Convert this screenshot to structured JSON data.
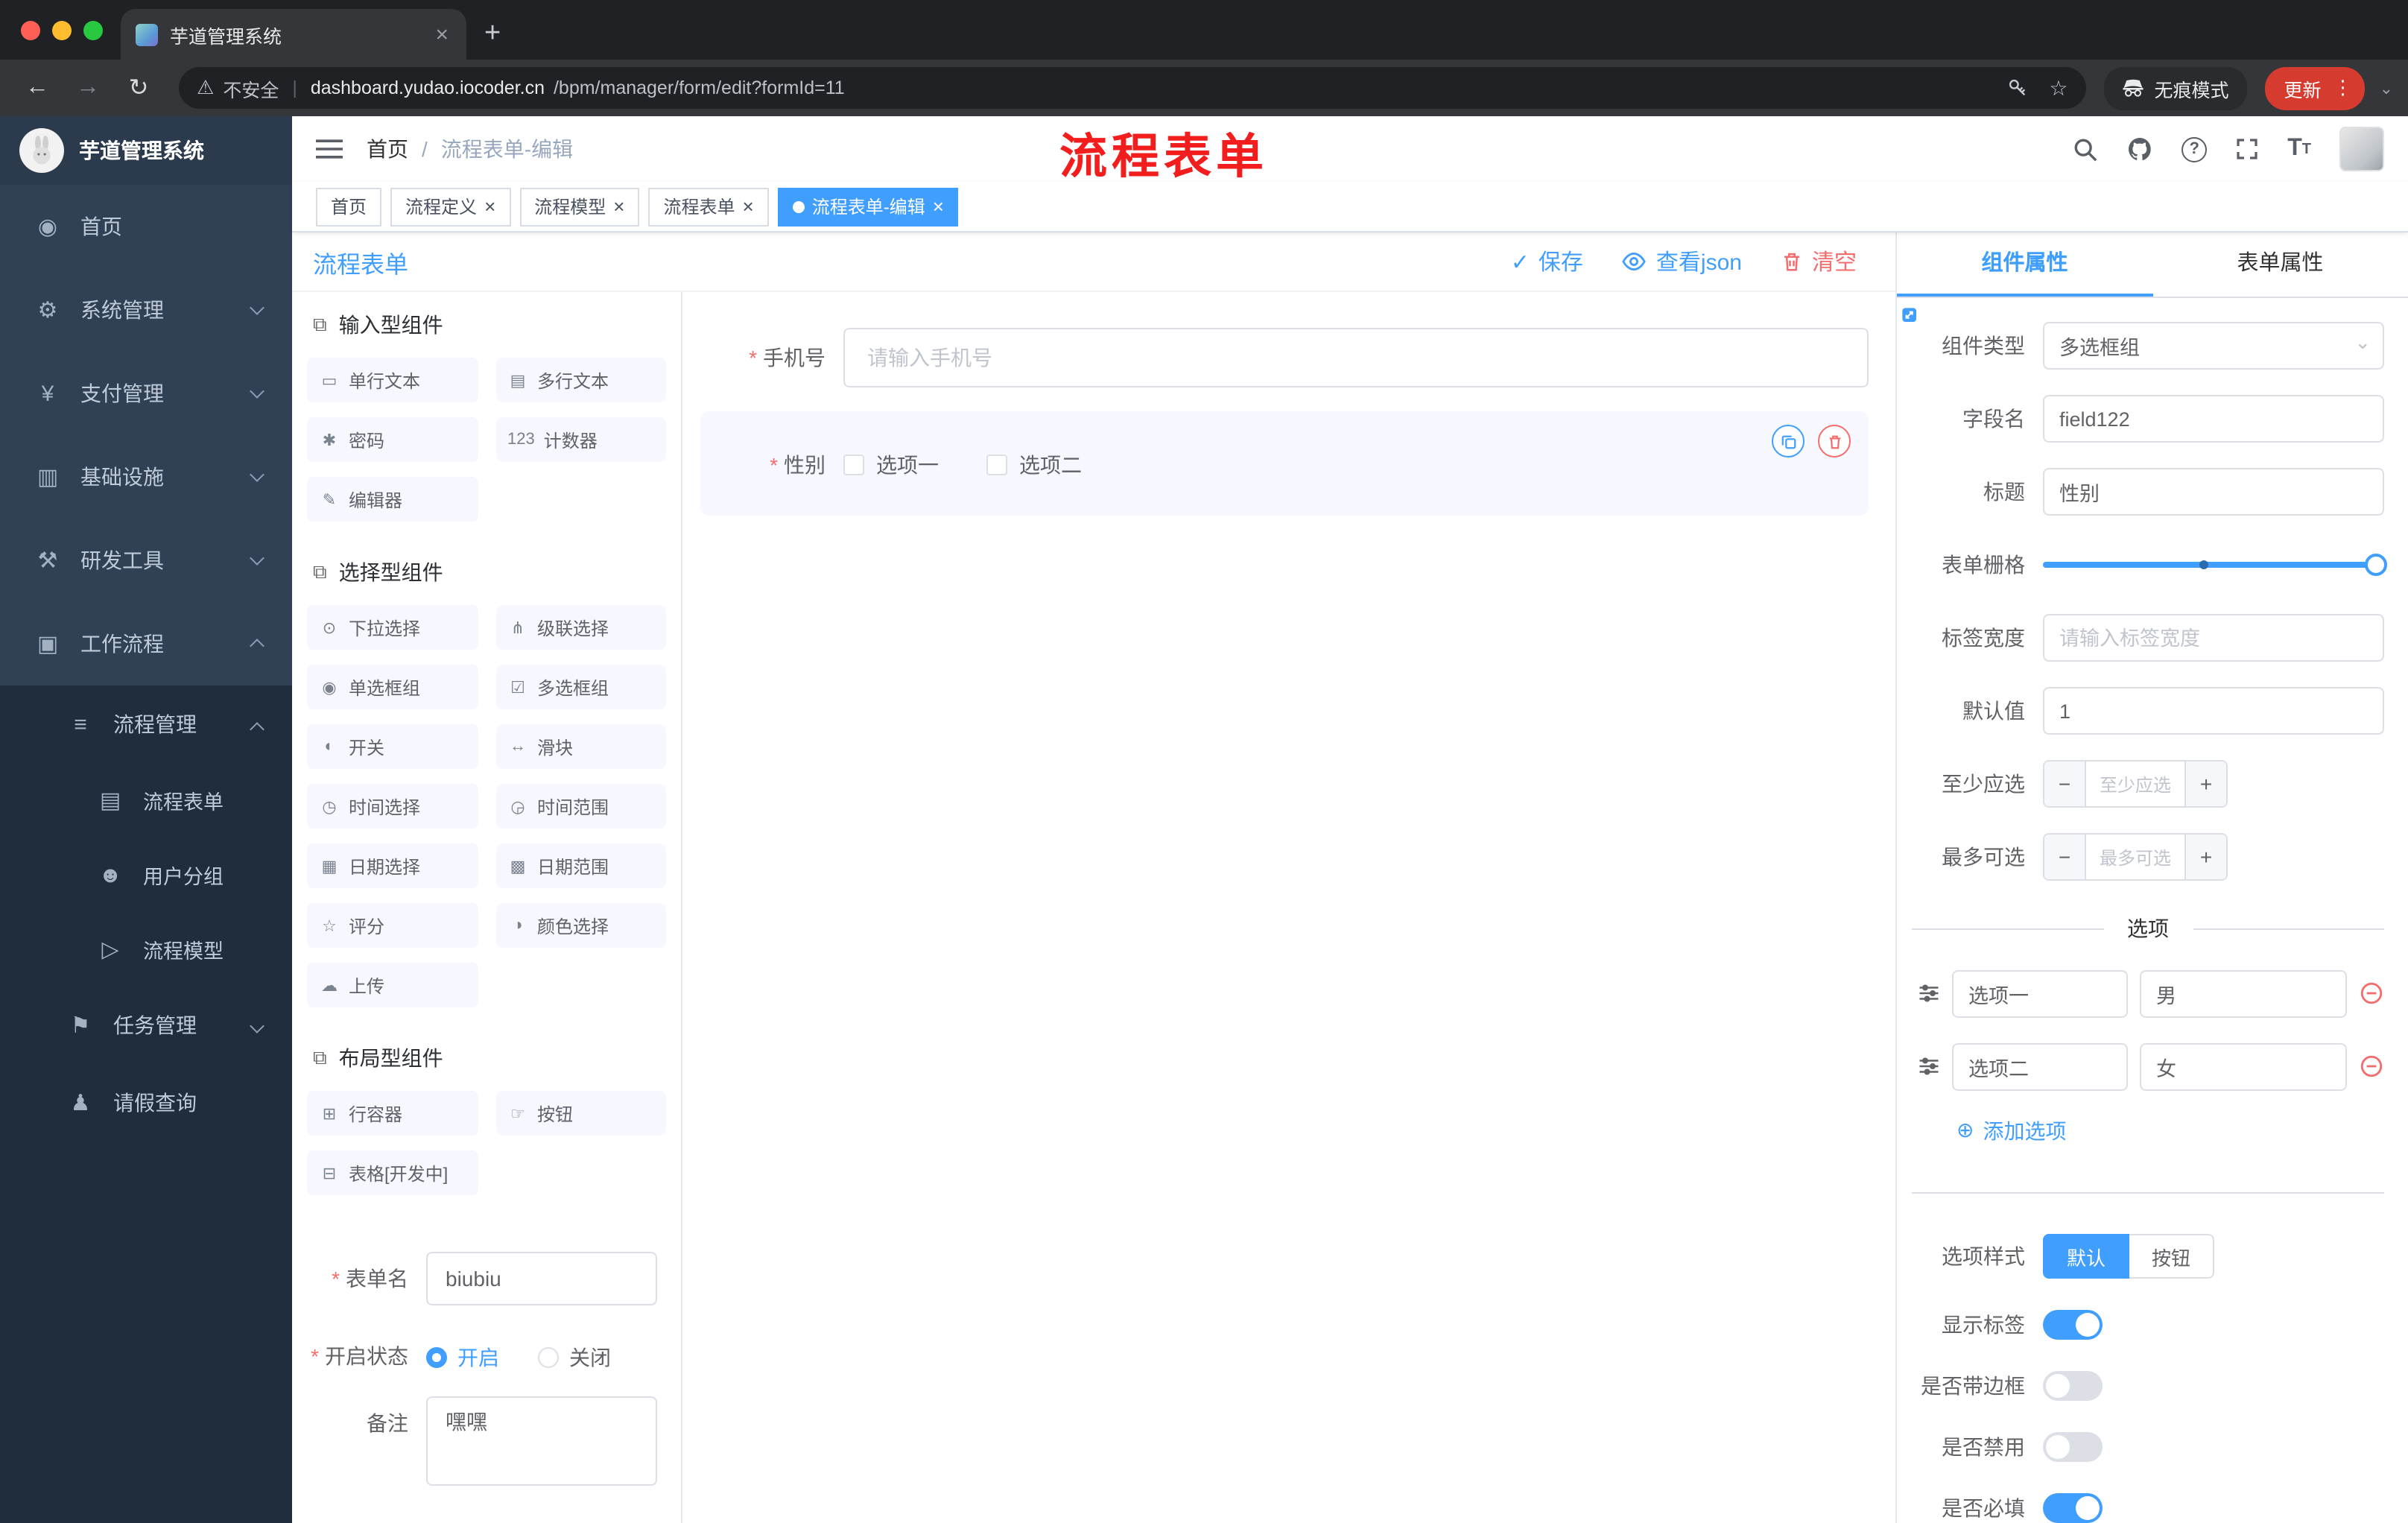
{
  "browser": {
    "tab_title": "芋道管理系统",
    "security_label": "不安全",
    "url_domain": "dashboard.yudao.iocoder.cn",
    "url_path": "/bpm/manager/form/edit?formId=11",
    "incognito_label": "无痕模式",
    "update_label": "更新"
  },
  "ui": {
    "back": "←",
    "forward": "→",
    "reload": "↻",
    "warning": "⚠",
    "pipe": "|",
    "close": "×",
    "plus": "+",
    "dots": "⋮",
    "caret": "⌄",
    "star": "☆",
    "check": "✓",
    "add": "⊕",
    "minus": "−",
    "question": "?",
    "t_big": "T",
    "t_small": "T",
    "group_icon": "⧉"
  },
  "annotation": {
    "text": "流程表单",
    "color": "#f21d1d"
  },
  "colors": {
    "primary": "#409eff",
    "danger": "#f56c6c",
    "sidebar": "#304156",
    "submenu": "#1f2d3d"
  },
  "sidebar": {
    "logo_title": "芋道管理系统",
    "items": [
      {
        "icon": "◉",
        "label": "首页"
      },
      {
        "icon": "⚙",
        "label": "系统管理"
      },
      {
        "icon": "¥",
        "label": "支付管理"
      },
      {
        "icon": "▥",
        "label": "基础设施"
      },
      {
        "icon": "⚒",
        "label": "研发工具"
      },
      {
        "icon": "▣",
        "label": "工作流程"
      },
      {
        "icon": "≡",
        "label": "流程管理"
      },
      {
        "icon": "▤",
        "label": "流程表单"
      },
      {
        "icon": "☻",
        "label": "用户分组"
      },
      {
        "icon": "▷",
        "label": "流程模型"
      },
      {
        "icon": "⚑",
        "label": "任务管理"
      },
      {
        "icon": "♟",
        "label": "请假查询"
      }
    ]
  },
  "header": {
    "breadcrumb_home": "首页",
    "breadcrumb_sep": "/",
    "breadcrumb_current": "流程表单-编辑"
  },
  "tags": [
    {
      "label": "首页"
    },
    {
      "label": "流程定义"
    },
    {
      "label": "流程模型"
    },
    {
      "label": "流程表单"
    },
    {
      "label": "流程表单-编辑"
    }
  ],
  "designer": {
    "title": "流程表单",
    "save_label": "保存",
    "view_json_label": "查看json",
    "clear_label": "清空",
    "palette": {
      "groups": [
        {
          "title": "输入型组件",
          "items": [
            {
              "icon": "▭",
              "label": "单行文本"
            },
            {
              "icon": "▤",
              "label": "多行文本"
            },
            {
              "icon": "✱",
              "label": "密码"
            },
            {
              "icon": "123",
              "label": "计数器"
            },
            {
              "icon": "✎",
              "label": "编辑器"
            }
          ]
        },
        {
          "title": "选择型组件",
          "items": [
            {
              "icon": "⊙",
              "label": "下拉选择"
            },
            {
              "icon": "⋔",
              "label": "级联选择"
            },
            {
              "icon": "◉",
              "label": "单选框组"
            },
            {
              "icon": "☑",
              "label": "多选框组"
            },
            {
              "icon": "◐",
              "label": "开关"
            },
            {
              "icon": "↔",
              "label": "滑块"
            },
            {
              "icon": "◷",
              "label": "时间选择"
            },
            {
              "icon": "◶",
              "label": "时间范围"
            },
            {
              "icon": "▦",
              "label": "日期选择"
            },
            {
              "icon": "▩",
              "label": "日期范围"
            },
            {
              "icon": "☆",
              "label": "评分"
            },
            {
              "icon": "◑",
              "label": "颜色选择"
            },
            {
              "icon": "☁",
              "label": "上传"
            }
          ]
        },
        {
          "title": "布局型组件",
          "items": [
            {
              "icon": "⊞",
              "label": "行容器"
            },
            {
              "icon": "☞",
              "label": "按钮"
            },
            {
              "icon": "⊟",
              "label": "表格[开发中]"
            }
          ]
        }
      ],
      "form_name_label": "表单名",
      "form_name_value": "biubiu",
      "status_label": "开启状态",
      "status_on": "开启",
      "status_off": "关闭",
      "remark_label": "备注",
      "remark_value": "嘿嘿"
    },
    "canvas": {
      "phone_label": "手机号",
      "phone_placeholder": "请输入手机号",
      "gender_label": "性别",
      "gender_option1": "选项一",
      "gender_option2": "选项二"
    },
    "props": {
      "tab_component": "组件属性",
      "tab_form": "表单属性",
      "component_type_label": "组件类型",
      "component_type_value": "多选框组",
      "field_name_label": "字段名",
      "field_name_value": "field122",
      "title_label": "标题",
      "title_value": "性别",
      "grid_label": "表单栅格",
      "label_width_label": "标签宽度",
      "label_width_placeholder": "请输入标签宽度",
      "default_label": "默认值",
      "default_value": "1",
      "min_label": "至少应选",
      "min_placeholder": "至少应选",
      "max_label": "最多可选",
      "max_placeholder": "最多可选",
      "options_title": "选项",
      "options": [
        {
          "label": "选项一",
          "value": "男"
        },
        {
          "label": "选项二",
          "value": "女"
        }
      ],
      "add_option_label": "添加选项",
      "style_label": "选项样式",
      "style_default": "默认",
      "style_button": "按钮",
      "toggle_show_label": "显示标签",
      "toggle_border_label": "是否带边框",
      "toggle_disabled_label": "是否禁用",
      "toggle_required_label": "是否必填"
    }
  }
}
